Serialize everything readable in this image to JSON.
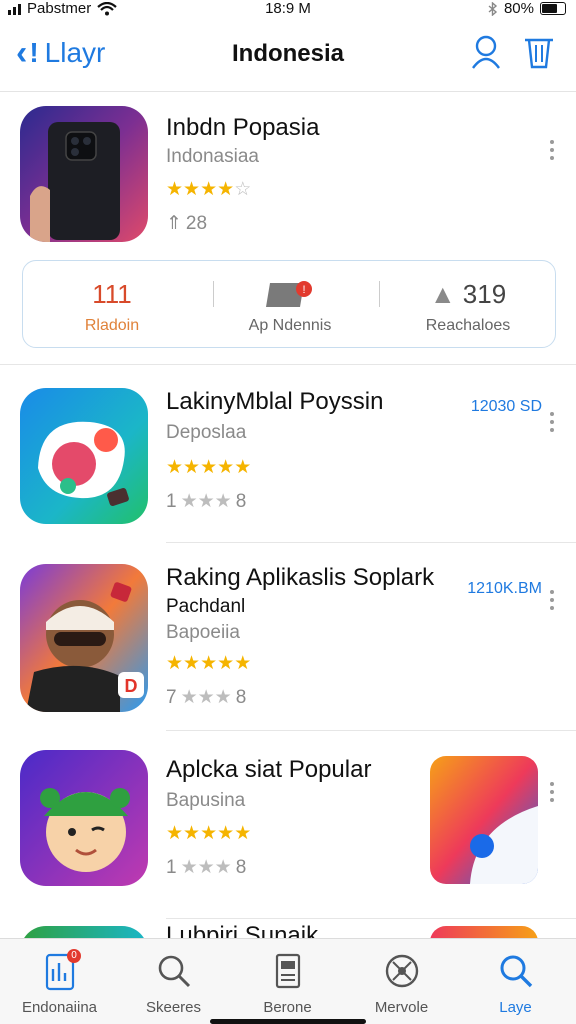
{
  "status": {
    "carrier": "Pabstmer",
    "time": "18:9 M",
    "battery": "80%"
  },
  "nav": {
    "back_label": "Llayr",
    "title": "Indonesia"
  },
  "featured": {
    "name": "Inbdn Popasia",
    "subtitle": "Indonasiaa",
    "rating": 3.5,
    "rating_text": "3.5 of 5",
    "downloads": "28",
    "stats": [
      {
        "value": "111",
        "label": "Rladoin"
      },
      {
        "value": "",
        "label": "Ap Ndennis"
      },
      {
        "value": "319",
        "label": "Reachaloes"
      }
    ]
  },
  "apps": [
    {
      "name": "LakinyMblal Poyssin",
      "subtitle": "Deposlaa",
      "rating": 4.5,
      "count": "1",
      "count_end": "8",
      "size": "12030 SD",
      "category": ""
    },
    {
      "name": "Raking Aplikaslis Soplark",
      "subtitle": "Bapoeiia",
      "category": "Pachdanl",
      "rating": 4.5,
      "count": "7",
      "count_end": "8",
      "size": "1210K.BM"
    },
    {
      "name": "Aplcka siat Popular",
      "subtitle": "Bapusina",
      "category": "",
      "rating": 4.5,
      "count": "1",
      "count_end": "8",
      "size": ""
    },
    {
      "name": "Lubpiri Sunaik",
      "subtitle": "",
      "category": "",
      "rating": 0,
      "count": "",
      "count_end": "",
      "size": ""
    }
  ],
  "tabs": [
    {
      "label": "Endonaiina",
      "badge": "0"
    },
    {
      "label": "Skeeres"
    },
    {
      "label": "Berone"
    },
    {
      "label": "Mervole"
    },
    {
      "label": "Laye"
    }
  ],
  "colors": {
    "accent": "#1f7ae0",
    "star": "#f5b400",
    "badge": "#e23a2e"
  },
  "icons": [
    "back-chevron-icon",
    "profile-icon",
    "trash-icon",
    "more-icon",
    "library-icon",
    "search-icon",
    "document-icon",
    "compass-icon"
  ]
}
